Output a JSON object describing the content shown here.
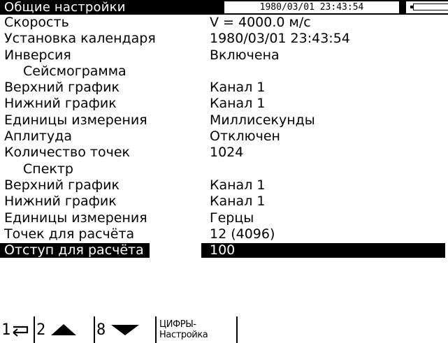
{
  "header": {
    "title": "Общие настройки",
    "datetime": "1980/03/01  23:43:54"
  },
  "rows": [
    {
      "label": "Скорость",
      "value": "V = 4000.0 м/с"
    },
    {
      "label": "Установка календаря",
      "value": "1980/03/01 23:43:54"
    },
    {
      "label": "Инверсия",
      "value": "Включена"
    },
    {
      "label": "Сейсмограмма",
      "value": ""
    },
    {
      "label": "Верхний график",
      "value": "Канал 1"
    },
    {
      "label": "Нижний график",
      "value": "Канал 1"
    },
    {
      "label": "Единицы измерения",
      "value": "Миллисекунды"
    },
    {
      "label": "Аплитуда",
      "value": "Отключен"
    },
    {
      "label": "Количество точек",
      "value": "1024"
    },
    {
      "label": "Спектр",
      "value": ""
    },
    {
      "label": "Верхний график",
      "value": "Канал 1"
    },
    {
      "label": "Нижний график",
      "value": "Канал 1"
    },
    {
      "label": "Единицы измерения",
      "value": "Герцы"
    },
    {
      "label": "Точек для расчёта",
      "value": "12 (4096)"
    },
    {
      "label": "Отступ для расчёта",
      "value": "100"
    }
  ],
  "softkeys": {
    "k1": {
      "num": "1",
      "icon": "return-arrow-icon"
    },
    "k2": {
      "num": "2",
      "icon": "arrow-up-icon"
    },
    "k3": {
      "num": "8",
      "icon": "arrow-down-icon"
    },
    "k4": {
      "label": "ЦИФРЫ-Настройка"
    }
  }
}
